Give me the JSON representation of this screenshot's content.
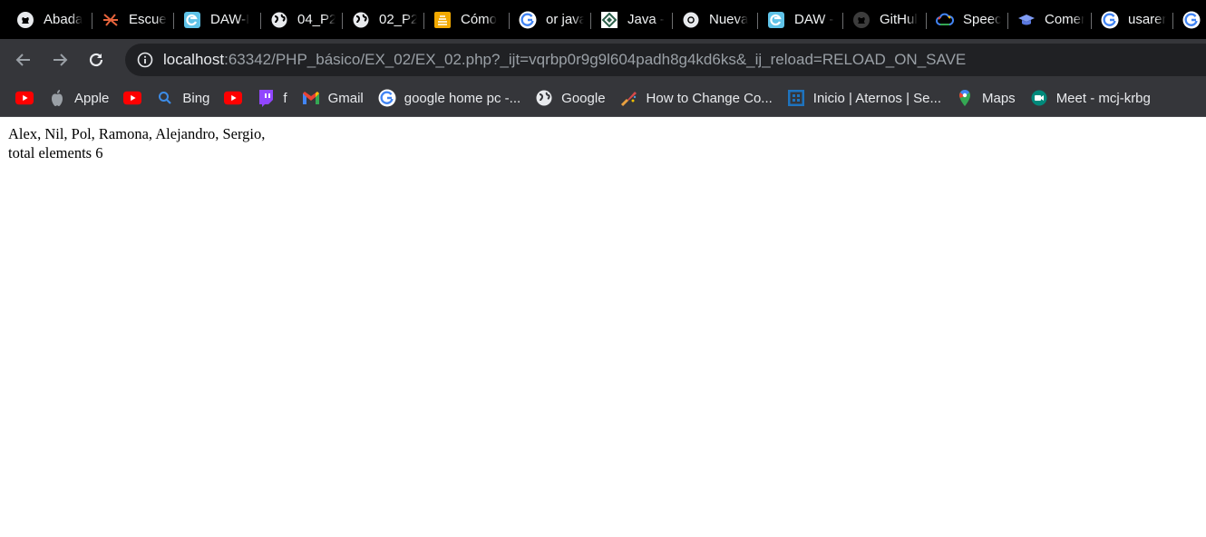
{
  "colors": {
    "tabstrip_bg": "#000000",
    "toolbar_bg": "#35363a",
    "omnibox_bg": "#202124",
    "page_bg": "#ffffff",
    "youtube_red": "#ff0000",
    "twitch_purple": "#9146ff"
  },
  "tabs": [
    {
      "title": "Abada",
      "icon": "github-icon"
    },
    {
      "title": "Escuel",
      "icon": "school-logo-icon"
    },
    {
      "title": "DAW-I",
      "icon": "edge-icon"
    },
    {
      "title": "04_P2.",
      "icon": "globe-icon"
    },
    {
      "title": "02_P2.",
      "icon": "globe-icon"
    },
    {
      "title": "Cómo",
      "icon": "stackoverflow-icon"
    },
    {
      "title": "or java",
      "icon": "google-icon"
    },
    {
      "title": "Java -",
      "icon": "java-site-icon"
    },
    {
      "title": "Nueva",
      "icon": "chrome-icon"
    },
    {
      "title": "DAW -",
      "icon": "edge-icon"
    },
    {
      "title": "GitHul",
      "icon": "github-icon"
    },
    {
      "title": "Speecl",
      "icon": "google-cloud-icon"
    },
    {
      "title": "Comer",
      "icon": "graduation-cap-icon"
    },
    {
      "title": "usaren",
      "icon": "google-icon"
    },
    {
      "title": "",
      "icon": "google-icon"
    }
  ],
  "omnibox": {
    "host": "localhost",
    "rest": ":63342/PHP_básico/EX_02/EX_02.php?_ijt=vqrbp0r9g9l604padh8g4kd6ks&_ij_reload=RELOAD_ON_SAVE"
  },
  "bookmarks": [
    {
      "label": "",
      "icon": "youtube-icon"
    },
    {
      "label": "Apple",
      "icon": "apple-icon"
    },
    {
      "label": "",
      "icon": "youtube-icon"
    },
    {
      "label": "Bing",
      "icon": "search-icon"
    },
    {
      "label": "",
      "icon": "youtube-icon"
    },
    {
      "label": "f",
      "icon": "twitch-icon"
    },
    {
      "label": "Gmail",
      "icon": "gmail-icon"
    },
    {
      "label": "google home pc -...",
      "icon": "google-icon"
    },
    {
      "label": "Google",
      "icon": "globe-icon"
    },
    {
      "label": "How to Change Co...",
      "icon": "brush-icon"
    },
    {
      "label": "Inicio | Aternos | Se...",
      "icon": "aternos-icon"
    },
    {
      "label": "Maps",
      "icon": "maps-pin-icon"
    },
    {
      "label": "Meet - mcj-krbg",
      "icon": "meet-icon"
    }
  ],
  "page": {
    "line1": "Alex, Nil, Pol, Ramona, Alejandro, Sergio,",
    "line2": "total elements 6"
  }
}
